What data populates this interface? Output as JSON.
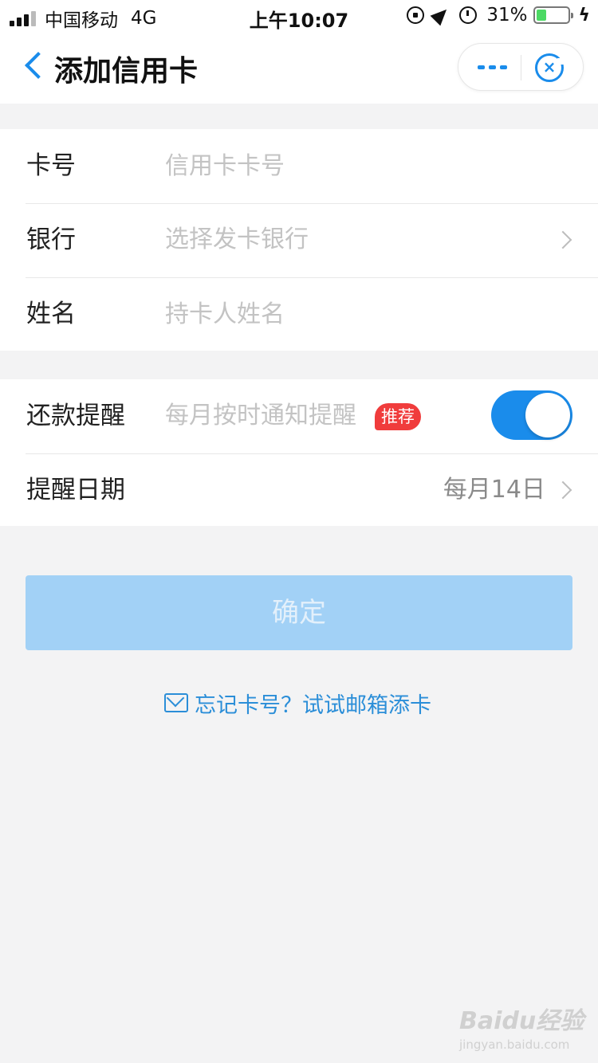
{
  "status_bar": {
    "carrier": "中国移动",
    "network": "4G",
    "time": "上午10:07",
    "battery_text": "31%",
    "battery_level": 0.31,
    "icons": [
      "rotation-lock-icon",
      "location-icon",
      "alarm-icon",
      "charging-icon"
    ]
  },
  "nav": {
    "title": "添加信用卡",
    "back_icon": "chevron-left-icon",
    "more_icon": "more-dots-icon",
    "close_icon": "close-circle-icon",
    "accent": "#1a8ceb"
  },
  "card_form": {
    "card_number": {
      "label": "卡号",
      "placeholder": "信用卡卡号"
    },
    "bank": {
      "label": "银行",
      "placeholder": "选择发卡银行"
    },
    "name": {
      "label": "姓名",
      "placeholder": "持卡人姓名"
    }
  },
  "reminder": {
    "label": "还款提醒",
    "hint": "每月按时通知提醒",
    "badge": "推荐",
    "badge_color": "#f03c3c",
    "enabled": true
  },
  "reminder_date": {
    "label": "提醒日期",
    "value": "每月14日"
  },
  "confirm": {
    "label": "确定",
    "disabled": true
  },
  "email_link": {
    "text": "忘记卡号？试试邮箱添卡",
    "icon": "mail-icon"
  },
  "watermark": {
    "logo": "Baidu经验",
    "url": "jingyan.baidu.com"
  }
}
